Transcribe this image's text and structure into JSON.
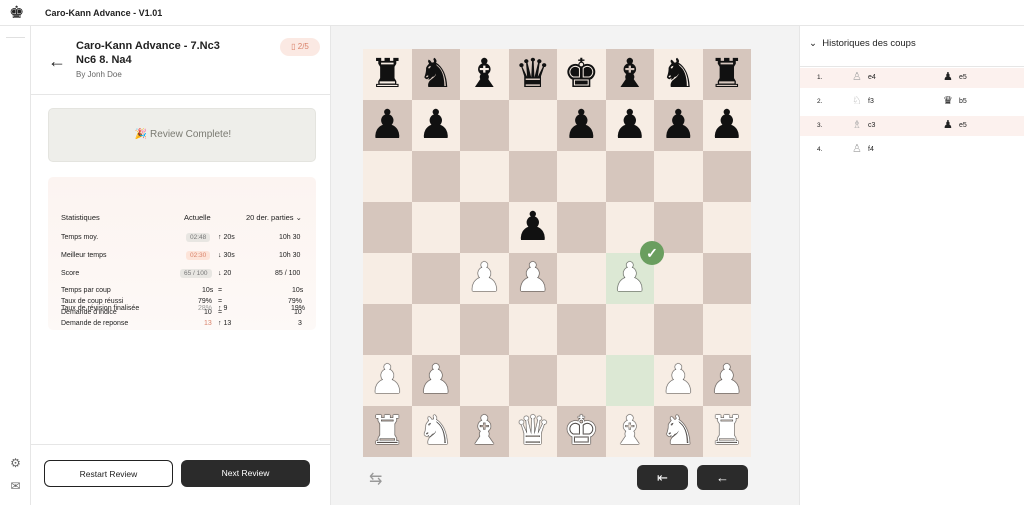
{
  "app": {
    "title": "Caro-Kann Advance - V1.01"
  },
  "lesson": {
    "title": "Caro-Kann Advance - 7.Nc3 Nc6 8. Na4",
    "author": "By Jonh Doe",
    "counter": "2/5"
  },
  "review": {
    "status": "Review Complete!"
  },
  "stats": {
    "header": {
      "label": "Statistiques",
      "current": "Actuelle",
      "range": "20 der. parties"
    },
    "rows": [
      {
        "label": "Temps moy.",
        "current": "02:48",
        "delta": "↑ 20s",
        "avg": "10h 30"
      },
      {
        "label": "Meilleur temps",
        "current": "02:30",
        "delta": "↓ 30s",
        "avg": "10h 30"
      },
      {
        "label": "Score",
        "current": "65 / 100",
        "delta": "↓ 20",
        "avg": "85 / 100"
      }
    ],
    "details": [
      {
        "label": "Temps par coup",
        "current": "10s",
        "delta": "=",
        "avg": "10s"
      },
      {
        "label": "Taux de coup réussi",
        "current": "79%",
        "delta": "=",
        "avg": "79%"
      },
      {
        "label": "Demande d'indice",
        "current": "10",
        "delta": "=",
        "avg": "10"
      },
      {
        "label": "Demande de reponse",
        "current": "13",
        "delta": "↑ 13",
        "avg": "3"
      },
      {
        "label": "Taux de révision finalisée",
        "current": "28%",
        "delta": "↑ 9",
        "avg": "19%"
      }
    ]
  },
  "buttons": {
    "restart": "Restart Review",
    "next": "Next Review"
  },
  "history": {
    "title": "Historiques des coups",
    "moves": [
      {
        "num": "1.",
        "white": "e4",
        "black": "e5",
        "white_icon": "♙",
        "black_icon": "♟"
      },
      {
        "num": "2.",
        "white": "f3",
        "black": "b5",
        "white_icon": "♘",
        "black_icon": "♛"
      },
      {
        "num": "3.",
        "white": "c3",
        "black": "e5",
        "white_icon": "♗",
        "black_icon": "♟"
      },
      {
        "num": "4.",
        "white": "f4",
        "black": "",
        "white_icon": "♙",
        "black_icon": ""
      }
    ]
  },
  "icons": {
    "logo": "king-logo-icon",
    "back": "arrow-left-icon",
    "book": "book-icon",
    "celebrate": "party-icon",
    "flip": "swap-icon",
    "settings": "gear-icon",
    "mail": "mail-icon"
  },
  "board": {
    "rows": [
      [
        "bR",
        "bN",
        "bB",
        "bQ",
        "bK",
        "bB",
        "bN",
        "bR"
      ],
      [
        "bP",
        "bP",
        "",
        "",
        "bP",
        "bP",
        "bP",
        "bP"
      ],
      [
        "",
        "",
        "",
        "",
        "",
        "",
        "",
        ""
      ],
      [
        "",
        "",
        "",
        "bP",
        "",
        "",
        "",
        ""
      ],
      [
        "",
        "",
        "wP",
        "wP",
        "",
        "wP",
        "",
        ""
      ],
      [
        "",
        "",
        "",
        "",
        "",
        "",
        "",
        ""
      ],
      [
        "wP",
        "wP",
        "",
        "",
        "",
        "",
        "wP",
        "wP"
      ],
      [
        "wR",
        "wN",
        "wB",
        "wQ",
        "wK",
        "wB",
        "wN",
        "wR"
      ]
    ],
    "highlights": [
      [
        4,
        5
      ],
      [
        6,
        5
      ]
    ],
    "check_square": [
      4,
      5
    ]
  },
  "colors": {
    "accent": "#d9826a",
    "dark": "#2b2b2b",
    "light_square": "#f7ede4",
    "dark_square": "#d6c6bd",
    "highlight": "#dce8d4",
    "success": "#6a9e5f"
  }
}
